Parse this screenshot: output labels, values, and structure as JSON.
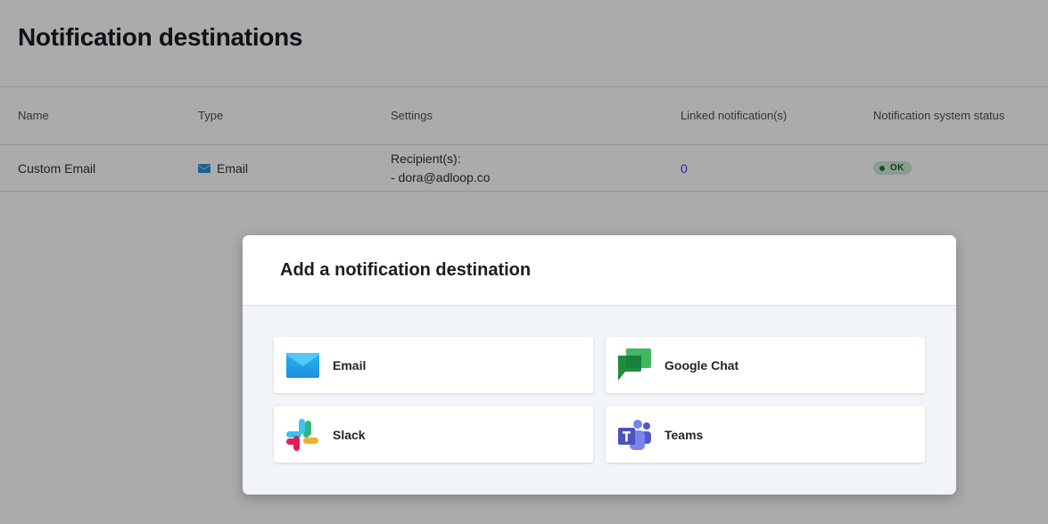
{
  "page": {
    "title": "Notification destinations"
  },
  "table": {
    "columns": [
      "Name",
      "Type",
      "Settings",
      "Linked notification(s)",
      "Notification system status"
    ],
    "rows": [
      {
        "name": "Custom Email",
        "type": "Email",
        "type_icon": "email-icon",
        "settings_label": "Recipient(s):",
        "settings_value": "- dora@adloop.co",
        "linked_count": "0",
        "status": "OK"
      }
    ]
  },
  "modal": {
    "title": "Add a notification destination",
    "options": [
      {
        "label": "Email",
        "icon": "email-icon"
      },
      {
        "label": "Google Chat",
        "icon": "google-chat-icon"
      },
      {
        "label": "Slack",
        "icon": "slack-icon"
      },
      {
        "label": "Teams",
        "icon": "teams-icon"
      }
    ]
  },
  "colors": {
    "overlay": "rgba(0,0,0,0.33)",
    "link": "#3d3ad1",
    "status_ok_bg": "#cfe9d6",
    "status_ok_fg": "#1d5e31"
  }
}
